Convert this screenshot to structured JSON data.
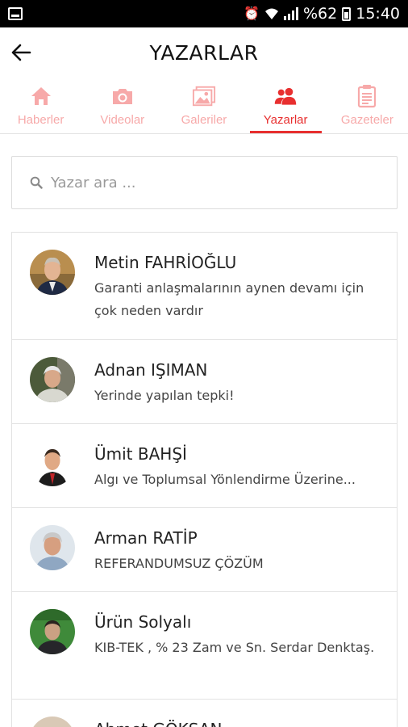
{
  "status_bar": {
    "battery_percent": "%62",
    "time": "15:40",
    "icons": [
      "app-notification-icon",
      "alarm-icon",
      "wifi-icon",
      "signal-icon",
      "battery-icon"
    ]
  },
  "header": {
    "title": "YAZARLAR",
    "back_icon": "arrow-left-icon"
  },
  "tabs": [
    {
      "label": "Haberler",
      "icon": "home-icon",
      "active": false
    },
    {
      "label": "Videolar",
      "icon": "camera-icon",
      "active": false
    },
    {
      "label": "Galeriler",
      "icon": "gallery-icon",
      "active": false
    },
    {
      "label": "Yazarlar",
      "icon": "users-icon",
      "active": true
    },
    {
      "label": "Gazeteler",
      "icon": "newspaper-icon",
      "active": false
    }
  ],
  "search": {
    "placeholder": "Yazar ara ...",
    "value": ""
  },
  "authors": [
    {
      "name": "Metin FAHRİOĞLU",
      "headline": "Garanti anlaşmalarının aynen devamı için çok neden vardır"
    },
    {
      "name": "Adnan IŞIMAN",
      "headline": "Yerinde yapılan tepki!"
    },
    {
      "name": "Ümit BAHŞİ",
      "headline": "Algı ve Toplumsal Yönlendirme Üzerine..."
    },
    {
      "name": "Arman RATİP",
      "headline": "REFERANDUMSUZ ÇÖZÜM"
    },
    {
      "name": "Ürün Solyalı",
      "headline": "KIB-TEK , % 23 Zam ve Sn. Serdar Denktaş."
    },
    {
      "name": "Ahmet GÖKSAN",
      "headline": ""
    }
  ],
  "colors": {
    "accent": "#e82f2f",
    "inactive_tab": "#f7a9a9",
    "status_bar": "#000000"
  }
}
